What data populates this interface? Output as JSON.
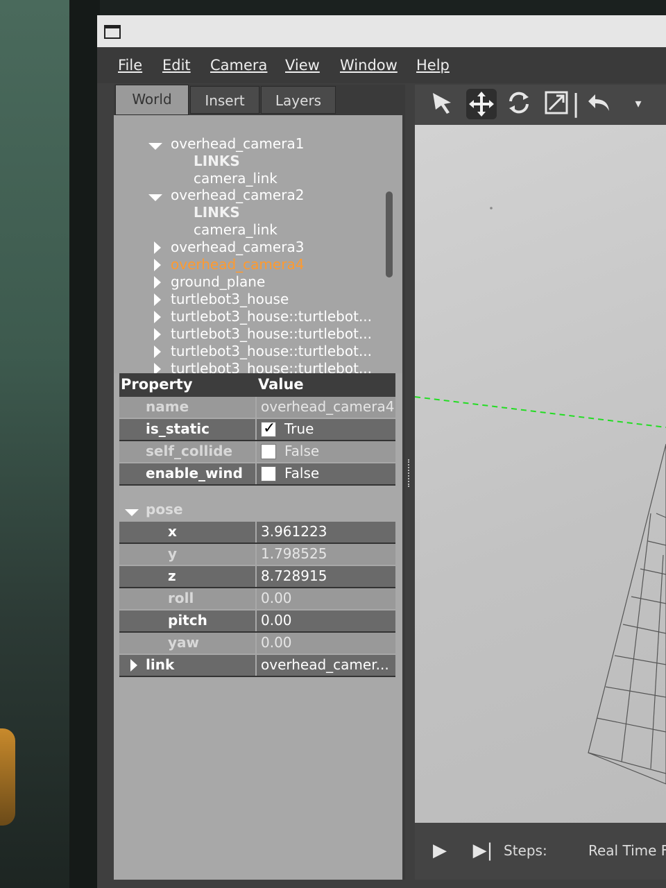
{
  "menu": [
    "File",
    "Edit",
    "Camera",
    "View",
    "Window",
    "Help"
  ],
  "tabs": [
    "World",
    "Insert",
    "Layers"
  ],
  "tree": [
    {
      "label": "overhead_camera1",
      "expanded": true
    },
    {
      "label": "LINKS",
      "kind": "group"
    },
    {
      "label": "camera_link",
      "kind": "leaf"
    },
    {
      "label": "overhead_camera2",
      "expanded": true
    },
    {
      "label": "LINKS",
      "kind": "group"
    },
    {
      "label": "camera_link",
      "kind": "leaf"
    },
    {
      "label": "overhead_camera3",
      "expanded": false
    },
    {
      "label": "overhead_camera4",
      "expanded": false,
      "selected": true
    },
    {
      "label": "ground_plane",
      "expanded": false
    },
    {
      "label": "turtlebot3_house",
      "expanded": false
    },
    {
      "label": "turtlebot3_house::turtlebot...",
      "expanded": false
    },
    {
      "label": "turtlebot3_house::turtlebot...",
      "expanded": false
    },
    {
      "label": "turtlebot3_house::turtlebot...",
      "expanded": false
    },
    {
      "label": "turtlebot3_house::turtlebot...",
      "expanded": false
    }
  ],
  "properties": {
    "header_property": "Property",
    "header_value": "Value",
    "name": {
      "key": "name",
      "value": "overhead_camera4"
    },
    "is_static": {
      "key": "is_static",
      "value": "True",
      "checked": true
    },
    "self_collide": {
      "key": "self_collide",
      "value": "False",
      "checked": false
    },
    "enable_wind": {
      "key": "enable_wind",
      "value": "False",
      "checked": false
    },
    "pose": {
      "key": "pose",
      "x": {
        "key": "x",
        "value": "3.961223"
      },
      "y": {
        "key": "y",
        "value": "1.798525"
      },
      "z": {
        "key": "z",
        "value": "8.728915"
      },
      "roll": {
        "key": "roll",
        "value": "0.00"
      },
      "pitch": {
        "key": "pitch",
        "value": "0.00"
      },
      "yaw": {
        "key": "yaw",
        "value": "0.00"
      }
    },
    "link": {
      "key": "link",
      "value": "overhead_camer..."
    }
  },
  "toolbar_icons": [
    "select-arrow-icon",
    "translate-icon",
    "rotate-icon",
    "scale-icon",
    "undo-icon",
    "dropdown-icon"
  ],
  "bottom_bar": {
    "steps_label": "Steps:",
    "real_time_label": "Real Time F"
  },
  "colors": {
    "selected_item": "#ff9a2e",
    "axis_line": "#22dd22"
  }
}
